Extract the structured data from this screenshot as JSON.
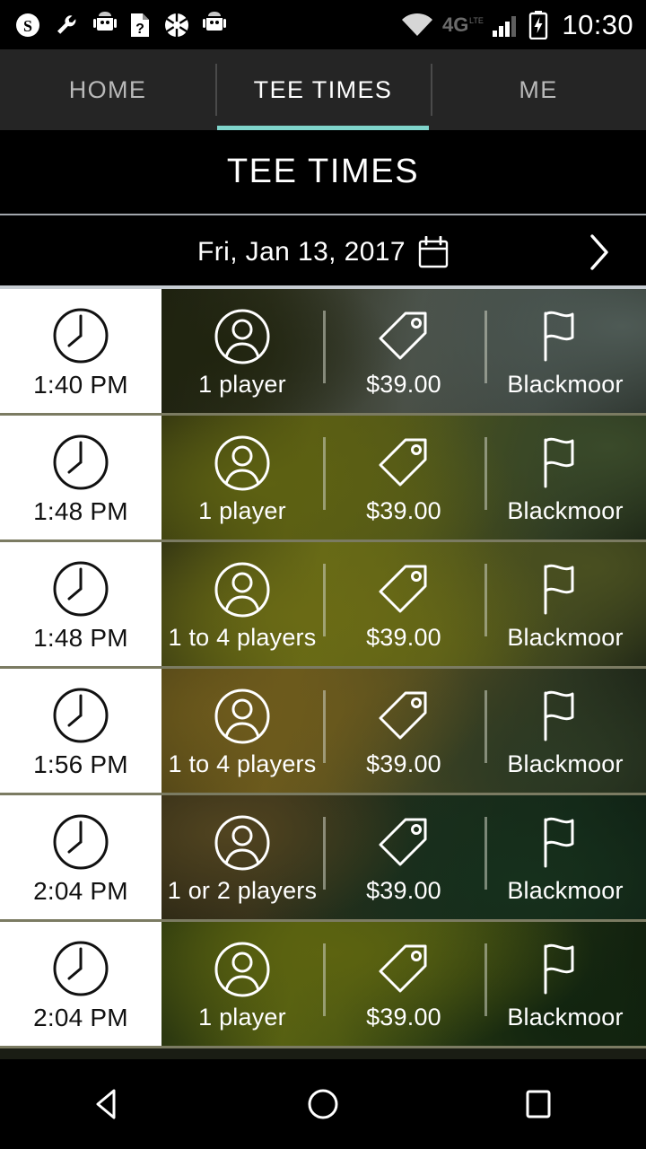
{
  "status_bar": {
    "time": "10:30",
    "network_label": "4G",
    "network_sub": "LTE",
    "left_icons": [
      {
        "name": "skype-icon",
        "glyph": "S"
      },
      {
        "name": "wrench-icon",
        "glyph": "⚒"
      },
      {
        "name": "android-robot-icon",
        "glyph": "●"
      },
      {
        "name": "sim-card-question-icon",
        "glyph": "?"
      },
      {
        "name": "asterisk-ball-icon",
        "glyph": "✸"
      },
      {
        "name": "android-robot-icon-2",
        "glyph": "●"
      }
    ],
    "right_icons": [
      {
        "name": "wifi-icon"
      },
      {
        "name": "signal-bars-icon"
      },
      {
        "name": "battery-charging-icon"
      }
    ]
  },
  "tabs": {
    "items": [
      {
        "label": "HOME",
        "selected": false
      },
      {
        "label": "TEE TIMES",
        "selected": true
      },
      {
        "label": "ME",
        "selected": false
      }
    ],
    "accent_color": "#7fd4cb"
  },
  "header": {
    "title": "TEE TIMES",
    "date": "Fri, Jan 13, 2017",
    "calendar_icon": "calendar-icon",
    "next_day_icon": "chevron-right-icon"
  },
  "tee_times": {
    "columns": [
      "time",
      "players",
      "price",
      "course"
    ],
    "rows": [
      {
        "time": "1:40 PM",
        "players": "1 player",
        "price": "$39.00",
        "course": "Blackmoor"
      },
      {
        "time": "1:48 PM",
        "players": "1 player",
        "price": "$39.00",
        "course": "Blackmoor"
      },
      {
        "time": "1:48 PM",
        "players": "1 to 4 players",
        "price": "$39.00",
        "course": "Blackmoor"
      },
      {
        "time": "1:56 PM",
        "players": "1 to 4 players",
        "price": "$39.00",
        "course": "Blackmoor"
      },
      {
        "time": "2:04 PM",
        "players": "1 or 2 players",
        "price": "$39.00",
        "course": "Blackmoor"
      },
      {
        "time": "2:04 PM",
        "players": "1 player",
        "price": "$39.00",
        "course": "Blackmoor"
      }
    ]
  },
  "nav_bar": {
    "back": "back-icon",
    "home": "home-icon",
    "recents": "recents-icon"
  },
  "colors": {
    "accent": "#7fd4cb",
    "tab_bar_bg": "#252525",
    "time_cell_bg": "#ffffff",
    "time_text": "#111111",
    "row_divider": "#7b7b62"
  }
}
